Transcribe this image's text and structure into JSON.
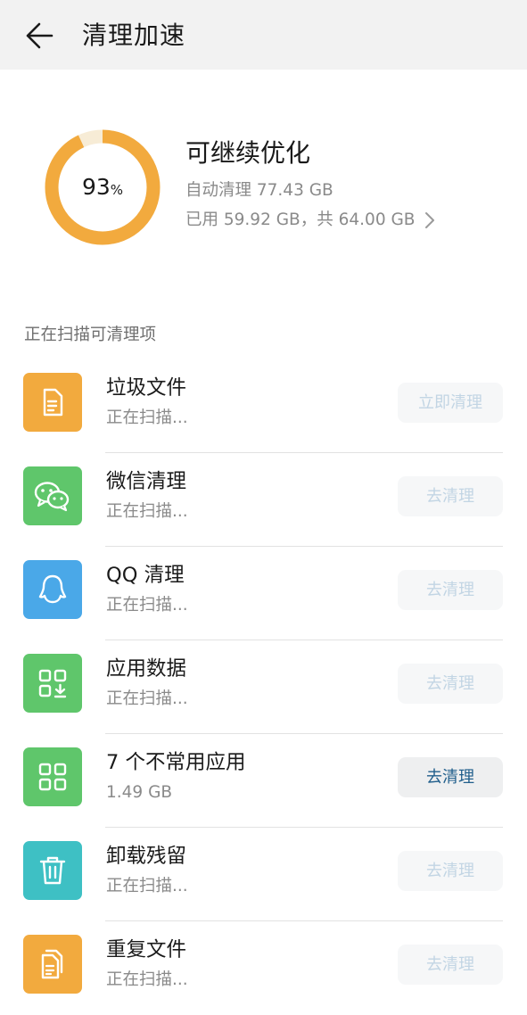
{
  "header": {
    "title": "清理加速"
  },
  "summary": {
    "percent": "93",
    "percent_unit": "%",
    "percent_value": 0.93,
    "title": "可继续优化",
    "auto_clean": "自动清理 77.43 GB",
    "storage": "已用 59.92 GB，共 64.00 GB",
    "ring_color": "#f2aa3e"
  },
  "section": {
    "label": "正在扫描可清理项"
  },
  "items": [
    {
      "title": "垃圾文件",
      "subtitle": "正在扫描...",
      "button": "立即清理",
      "icon": "document-icon",
      "color": "#f2aa3e"
    },
    {
      "title": "微信清理",
      "subtitle": "正在扫描...",
      "button": "去清理",
      "icon": "wechat-icon",
      "color": "#5fc66b"
    },
    {
      "title": "QQ 清理",
      "subtitle": "正在扫描...",
      "button": "去清理",
      "icon": "qq-penguin-icon",
      "color": "#4aa8e8"
    },
    {
      "title": "应用数据",
      "subtitle": "正在扫描...",
      "button": "去清理",
      "icon": "app-data-icon",
      "color": "#5fc66b"
    },
    {
      "title": "7 个不常用应用",
      "subtitle": "1.49 GB",
      "button": "去清理",
      "icon": "apps-grid-icon",
      "color": "#5fc66b"
    },
    {
      "title": "卸载残留",
      "subtitle": "正在扫描...",
      "button": "去清理",
      "icon": "trash-icon",
      "color": "#3ec0c4"
    },
    {
      "title": "重复文件",
      "subtitle": "正在扫描...",
      "button": "去清理",
      "icon": "duplicate-files-icon",
      "color": "#f2aa3e"
    }
  ]
}
